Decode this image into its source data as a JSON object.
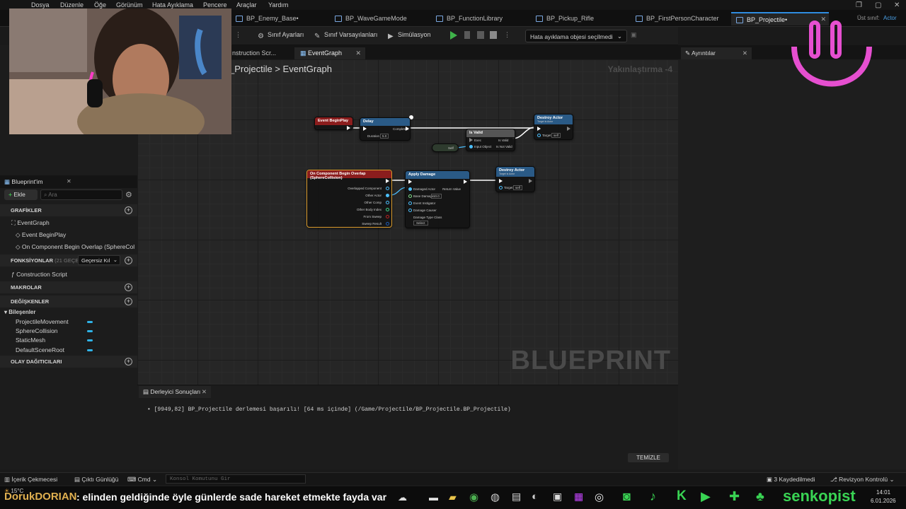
{
  "menu": [
    "Dosya",
    "Düzenle",
    "Öğe",
    "Görünüm",
    "Hata Ayıklama",
    "Pencere",
    "Araçlar",
    "Yardım"
  ],
  "tabs": [
    {
      "label": "BP_Enemy_Base•"
    },
    {
      "label": "BP_WaveGameMode"
    },
    {
      "label": "BP_FunctionLibrary"
    },
    {
      "label": "BP_Pickup_Rifle"
    },
    {
      "label": "BP_FirstPersonCharacter"
    },
    {
      "label": "BP_Projectile•"
    }
  ],
  "parent_class": {
    "label": "Üst sınıf:",
    "value": "Actor"
  },
  "toolbar": {
    "class_settings": "Sınıf Ayarları",
    "class_defaults": "Sınıf Varsayılanları",
    "simulation": "Simülasyon",
    "debug_object": "Hata ayıklama objesi seçilmedi"
  },
  "graph_tabs": {
    "construction": "nstruction Scr...",
    "eventgraph": "EventGraph"
  },
  "breadcrumb": {
    "root": "_Projectile",
    "sep": ">",
    "current": "EventGraph"
  },
  "zoom": "Yakınlaştırma -4",
  "watermark": "BLUEPRINT",
  "details": {
    "tab": "Ayrıntılar"
  },
  "nodes": {
    "begin_play": "Event BeginPlay",
    "delay": "Delay",
    "delay_duration": "Duration",
    "delay_completed": "Completed",
    "delay_value": "5.0",
    "is_valid": "Is Valid",
    "is_valid_exec": "Exec",
    "is_valid_input": "Input Object",
    "is_valid_yes": "Is Valid",
    "is_valid_no": "Is Not Valid",
    "self": "Self",
    "destroy1": "Destroy Actor",
    "destroy1_sub": "Target is Actor",
    "destroy_target": "Target",
    "destroy_self": "self",
    "overlap": "On Component Begin Overlap (SphereCollision)",
    "overlap_pins": [
      "Overlapped Component",
      "Other Actor",
      "Other Comp",
      "Other Body Index",
      "From Sweep",
      "Sweep Result"
    ],
    "apply_damage": "Apply Damage",
    "apply_pins": [
      "Damaged Actor",
      "Base Damage",
      "Event Instigator",
      "Damage Causer",
      "Damage Type Class"
    ],
    "apply_base": "10.0",
    "apply_return": "Return Value",
    "apply_select": "Select",
    "destroy2": "Destroy Actor",
    "destroy2_sub": "Target is Actor"
  },
  "blueprint_panel": {
    "title": "Blueprint'im",
    "add": "Ekle",
    "search_placeholder": "Ara",
    "graphs_header": "GRAFİKLER",
    "eventgraph": "EventGraph",
    "event_beginplay": "Event BeginPlay",
    "on_overlap": "On Component Begin Overlap (SphereCol",
    "functions_header": "FONKSİYONLAR",
    "functions_note": "(21 GEÇERS",
    "invalid_dropdown": "Geçersiz Kıl",
    "construction": "Construction Script",
    "macros_header": "MAKROLAR",
    "variables_header": "DEĞİŞKENLER",
    "components_header": "Bileşenler",
    "components": [
      "ProjectileMovement",
      "SphereCollision",
      "StaticMesh",
      "DefaultSceneRoot"
    ],
    "dispatchers_header": "OLAY DAĞITICILARI"
  },
  "compiler": {
    "tab": "Derleyici Sonuçları",
    "message": "[9949,82] BP_Projectile derlemesi başarılı! [64 ms içinde] (/Game/Projectile/BP_Projectile.BP_Projectile)",
    "clear": "TEMİZLE"
  },
  "statusbar": {
    "content_drawer": "İçerik Çekmecesi",
    "output_log": "Çıktı Günlüğü",
    "cmd": "Cmd",
    "console_placeholder": "Konsol Komutunu Gir",
    "saved": "3 Kaydedilmedi",
    "revision": "Revizyon Kontrolü"
  },
  "overlay": {
    "chat_user": "DorukDORIAN",
    "chat_message": ": elinden geldiğinde öyle günlerde sade hareket etmekte fayda var",
    "brand": "senkopist",
    "weather": "15°C",
    "time": "14:01",
    "date": "6.01.2026"
  },
  "colors": {
    "accent": "#2f8ce0",
    "play": "#3fb34a",
    "var_pill": "#2fb3e8",
    "event_head": "#8b1d1d",
    "func_head": "#2a5a86",
    "overlap_border": "#d99a2b",
    "brand_green": "#39d353",
    "smiley": "#e64fd0"
  }
}
